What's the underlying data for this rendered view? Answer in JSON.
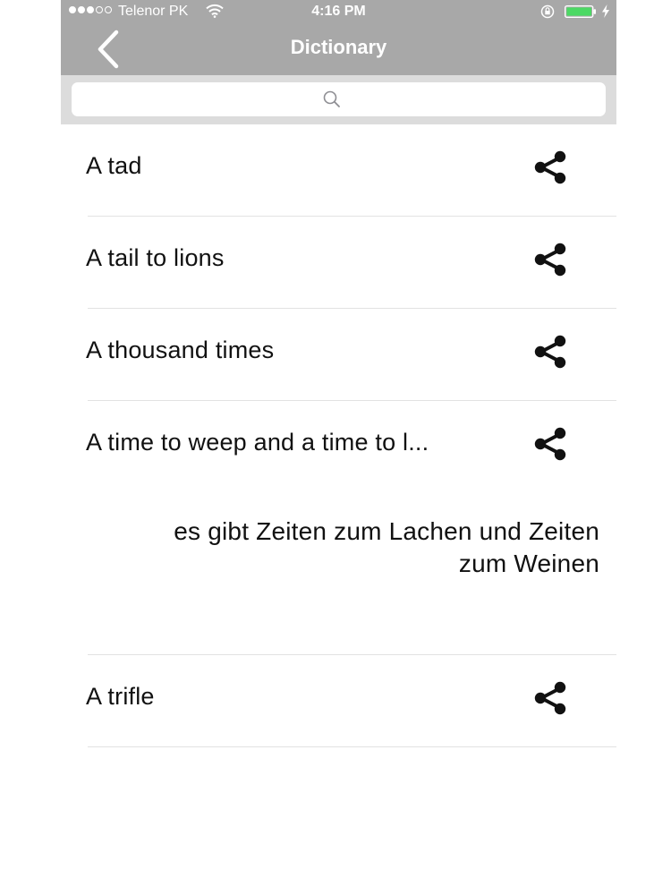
{
  "status_bar": {
    "carrier": "Telenor PK",
    "time": "4:16 PM"
  },
  "nav": {
    "title": "Dictionary"
  },
  "search": {
    "placeholder": ""
  },
  "entries": [
    {
      "term": "A tad"
    },
    {
      "term": "A tail to lions"
    },
    {
      "term": "A thousand times"
    },
    {
      "term": "A time to weep and a time to l...",
      "translation": "es gibt Zeiten zum Lachen und Zeiten zum Weinen"
    },
    {
      "term": "A trifle"
    }
  ],
  "icons": {
    "back": "chevron-left-icon",
    "search": "search-icon",
    "share": "share-icon",
    "wifi": "wifi-icon",
    "lock": "rotation-lock-icon",
    "battery": "battery-icon",
    "charging": "lightning-bolt-icon"
  },
  "colors": {
    "navbar": "#a8a8a8",
    "searchbar": "#dcdcdc",
    "battery": "#4cd964",
    "divider": "#e2e2e2"
  }
}
